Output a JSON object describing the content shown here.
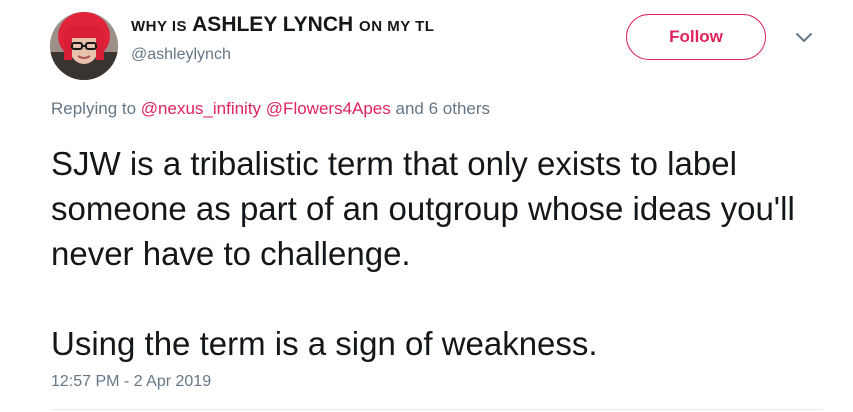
{
  "author": {
    "display_name_part1": "why is",
    "display_name_part2": "ASHLEY LYNCH",
    "display_name_part3": "on my tl",
    "handle": "@ashleylynch",
    "avatar_icon": "profile-avatar-red-hair"
  },
  "actions": {
    "follow_label": "Follow",
    "more_icon": "chevron-down-icon"
  },
  "reply": {
    "prefix": "Replying to",
    "mention1": "@nexus_infinity",
    "mention2": "@Flowers4Apes",
    "suffix": "and 6 others"
  },
  "tweet": {
    "paragraph1": "SJW is a tribalistic term that only exists to label someone as part of an outgroup whose ideas you'll never have to challenge.",
    "paragraph2": "Using the term is a sign of weakness.",
    "timestamp": "12:57 PM - 2 Apr 2019"
  },
  "colors": {
    "accent": "#e0245e",
    "secondary_text": "#657786",
    "primary_text": "#14171a",
    "divider": "#e6ecf0"
  }
}
